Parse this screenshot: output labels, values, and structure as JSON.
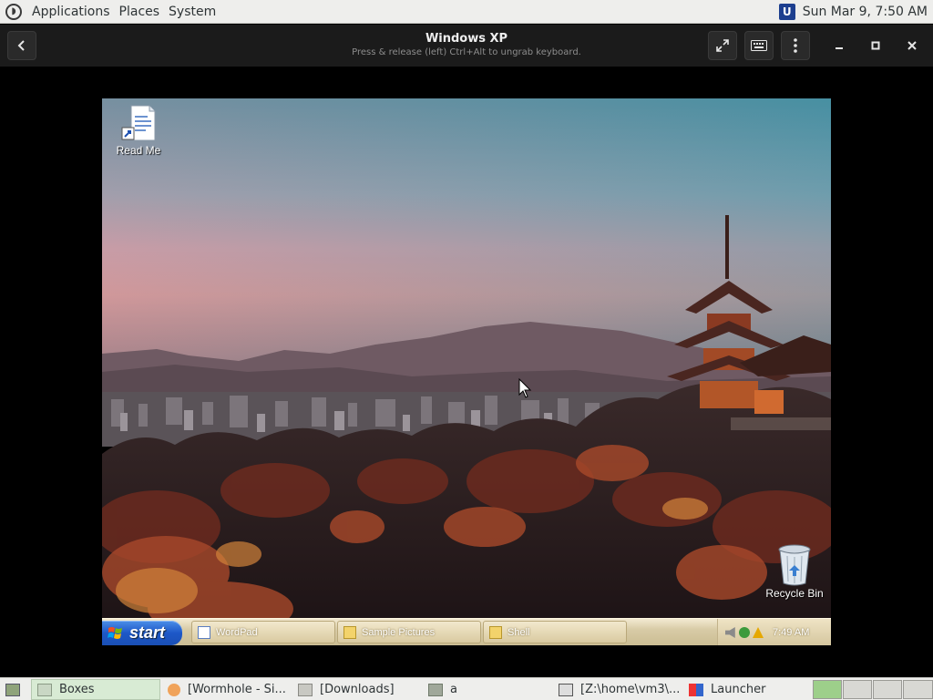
{
  "top_panel": {
    "menus": [
      "Applications",
      "Places",
      "System"
    ],
    "clock": "Sun Mar  9,  7:50 AM"
  },
  "header": {
    "title": "Windows XP",
    "subtitle": "Press & release (left) Ctrl+Alt to ungrab keyboard.",
    "back_icon": "chevron-left-icon",
    "fullscreen_icon": "fullscreen-icon",
    "keyboard_icon": "keyboard-icon",
    "menu_icon": "kebab-menu-icon",
    "minimize_icon": "minimize-icon",
    "maximize_icon": "maximize-icon",
    "close_icon": "close-icon"
  },
  "xp_desktop": {
    "icons": [
      {
        "label": "Read Me"
      },
      {
        "label": "Recycle Bin"
      }
    ],
    "start_label": "start",
    "taskbar_items": [
      {
        "label": "WordPad"
      },
      {
        "label": "Sample Pictures"
      },
      {
        "label": "Shell"
      }
    ],
    "tray_clock": "7:49 AM"
  },
  "bottom_panel": {
    "items": [
      {
        "label": "Boxes"
      },
      {
        "label": "[Wormhole - Si..."
      },
      {
        "label": "[Downloads]"
      },
      {
        "label": "a"
      },
      {
        "label": "[Z:\\home\\vm3\\..."
      },
      {
        "label": "Launcher"
      }
    ]
  },
  "colors": {
    "panel_bg": "#eeeeec",
    "header_bg": "#1b1b1b",
    "xp_start_blue": "#1d58c8",
    "xp_taskbar": "#d8cba6"
  }
}
